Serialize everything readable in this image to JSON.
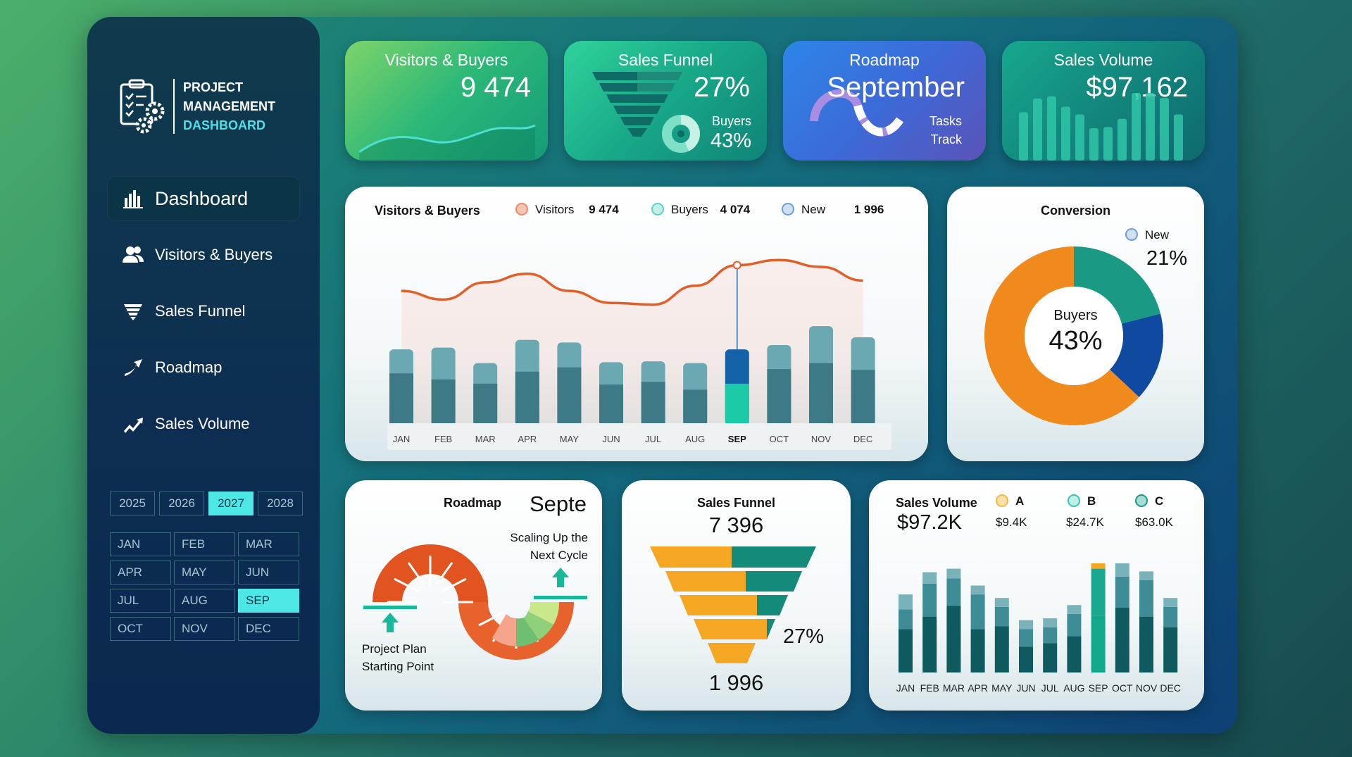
{
  "brand": {
    "line1": "PROJECT",
    "line2": "MANAGEMENT",
    "line3": "DASHBOARD"
  },
  "nav": [
    {
      "label": "Dashboard",
      "icon": "bar-chart-icon",
      "active": true
    },
    {
      "label": "Visitors & Buyers",
      "icon": "users-icon",
      "active": false
    },
    {
      "label": "Sales Funnel",
      "icon": "funnel-icon",
      "active": false
    },
    {
      "label": "Roadmap",
      "icon": "roadmap-icon",
      "active": false
    },
    {
      "label": "Sales Volume",
      "icon": "trend-icon",
      "active": false
    }
  ],
  "years": [
    "2025",
    "2026",
    "2027",
    "2028"
  ],
  "selected_year": "2027",
  "months": [
    "JAN",
    "FEB",
    "MAR",
    "APR",
    "MAY",
    "JUN",
    "JUL",
    "AUG",
    "SEP",
    "OCT",
    "NOV",
    "DEC"
  ],
  "selected_month": "SEP",
  "kpis": {
    "visitors": {
      "title": "Visitors & Buyers",
      "value": "9 474"
    },
    "funnel": {
      "title": "Sales Funnel",
      "value": "27%",
      "sub_label": "Buyers",
      "sub_value": "43%"
    },
    "roadmap": {
      "title": "Roadmap",
      "value": "September",
      "sub1": "Tasks",
      "sub2": "Track"
    },
    "volume": {
      "title": "Sales Volume",
      "value": "$97,162"
    }
  },
  "visitors_card": {
    "title": "Visitors & Buyers",
    "legend": [
      {
        "label": "Visitors",
        "value": "9 474",
        "color": "#f4a58a"
      },
      {
        "label": "Buyers",
        "value": "4 074",
        "color": "#7fd9d0"
      },
      {
        "label": "New",
        "value": "1 996",
        "color": "#8fb8e0"
      }
    ]
  },
  "conversion": {
    "title": "Conversion",
    "new_label": "New",
    "new_value": "21%",
    "center_label": "Buyers",
    "center_value": "43%"
  },
  "roadmap_card": {
    "title": "Roadmap",
    "month": "Septe",
    "end1": "Scaling Up the",
    "end2": "Next Cycle",
    "start1": "Project Plan",
    "start2": "Starting Point"
  },
  "funnel_card": {
    "title": "Sales Funnel",
    "top": "7 396",
    "pct": "27%",
    "bottom": "1 996"
  },
  "volume_card": {
    "title": "Sales Volume",
    "total": "$97.2K",
    "legend": [
      {
        "label": "A",
        "value": "$9.4K",
        "color": "#f5b94a"
      },
      {
        "label": "B",
        "value": "$24.7K",
        "color": "#5fd9c9"
      },
      {
        "label": "C",
        "value": "$63.0K",
        "color": "#3fb8a8"
      }
    ]
  },
  "chart_data": [
    {
      "type": "bar",
      "title": "Visitors & Buyers",
      "categories": [
        "JAN",
        "FEB",
        "MAR",
        "APR",
        "MAY",
        "JUN",
        "JUL",
        "AUG",
        "SEP",
        "OCT",
        "NOV",
        "DEC"
      ],
      "series": [
        {
          "name": "Visitors",
          "type": "line",
          "values": [
            770,
            720,
            820,
            870,
            770,
            700,
            690,
            800,
            920,
            950,
            910,
            830
          ]
        },
        {
          "name": "Buyers",
          "values": [
            430,
            440,
            350,
            485,
            470,
            355,
            360,
            350,
            430,
            455,
            565,
            500
          ]
        },
        {
          "name": "New",
          "values": [
            290,
            255,
            230,
            300,
            325,
            225,
            240,
            195,
            230,
            315,
            350,
            310
          ]
        }
      ],
      "highlight": "SEP"
    },
    {
      "type": "pie",
      "title": "Conversion",
      "slices": [
        {
          "label": "New",
          "value": 21,
          "color": "#1a9a85"
        },
        {
          "label": "",
          "value": 16,
          "color": "#0f4aa0"
        },
        {
          "label": "",
          "value": 63,
          "color": "#f08a1d"
        }
      ]
    },
    {
      "type": "bar",
      "title": "Sales Volume",
      "categories": [
        "JAN",
        "FEB",
        "MAR",
        "APR",
        "MAY",
        "JUN",
        "JUL",
        "AUG",
        "SEP",
        "OCT",
        "NOV",
        "DEC"
      ],
      "series": [
        {
          "name": "C",
          "values": [
            4.9,
            6.3,
            7.5,
            4.9,
            5.2,
            2.9,
            3.3,
            4.1,
            6.4,
            7.3,
            6.3,
            5.1
          ]
        },
        {
          "name": "B",
          "values": [
            2.2,
            3.7,
            3.1,
            3.9,
            2.2,
            2.0,
            1.8,
            2.5,
            5.3,
            3.5,
            4.1,
            2.3
          ]
        },
        {
          "name": "A",
          "values": [
            1.7,
            1.3,
            1.1,
            1.0,
            1.0,
            1.0,
            1.0,
            1.0,
            0.6,
            1.5,
            1.0,
            1.0
          ]
        }
      ],
      "highlight": "SEP"
    }
  ]
}
